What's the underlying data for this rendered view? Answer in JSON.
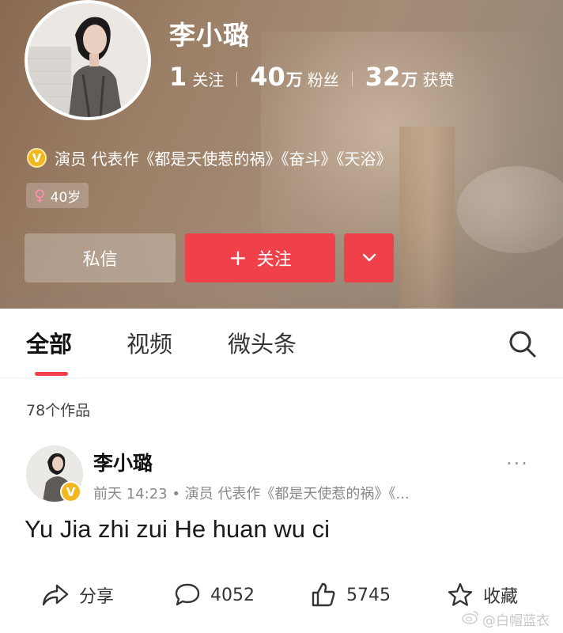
{
  "profile": {
    "name": "李小璐",
    "stats": [
      {
        "num": "1",
        "unit": "",
        "label": "关注"
      },
      {
        "num": "40",
        "unit": "万",
        "label": "粉丝"
      },
      {
        "num": "32",
        "unit": "万",
        "label": "获赞"
      }
    ],
    "verified_badge": "V",
    "verified_text": "演员 代表作《都是天使惹的祸》《奋斗》《天浴》",
    "gender_symbol": "♀",
    "age": "40岁",
    "buttons": {
      "message": "私信",
      "follow_plus": "+",
      "follow": "关注"
    }
  },
  "tabs": [
    {
      "label": "全部",
      "active": true
    },
    {
      "label": "视频",
      "active": false
    },
    {
      "label": "微头条",
      "active": false
    }
  ],
  "works_count": "78个作品",
  "post": {
    "author": "李小璐",
    "meta": "前天  14:23 • 演员 代表作《都是天使惹的祸》《...",
    "more": "···",
    "text": "Yu Jia zhi zui He huan wu ci",
    "actions": {
      "share": "分享",
      "comments": "4052",
      "likes": "5745",
      "favorite": "收藏"
    }
  },
  "watermark": "@白帽蓝衣",
  "colors": {
    "accent": "#f0404a",
    "verified": "#f2b820"
  },
  "icons": [
    "search-icon",
    "share-icon",
    "comment-icon",
    "like-icon",
    "star-icon",
    "chevron-down-icon",
    "weibo-icon"
  ]
}
